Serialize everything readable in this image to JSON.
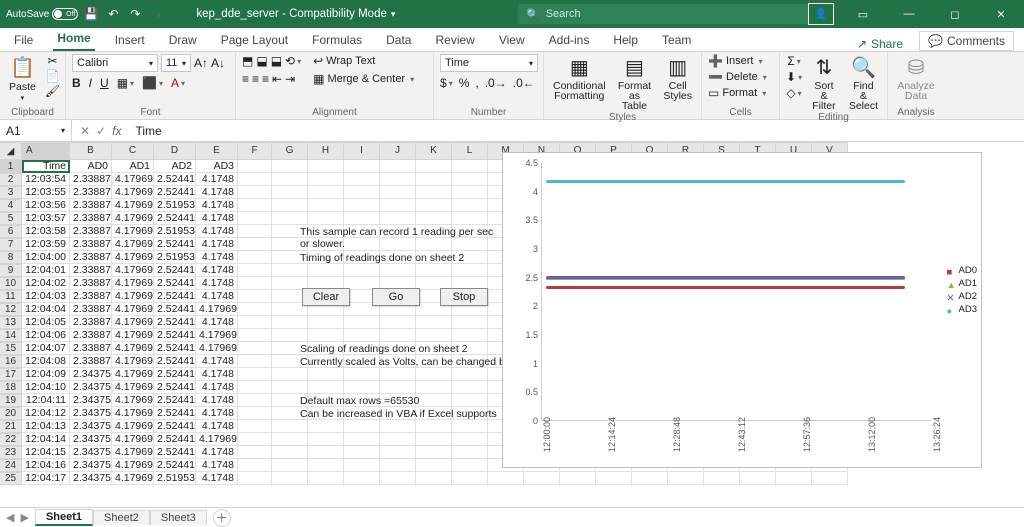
{
  "titlebar": {
    "autosave": "AutoSave",
    "off": "Off",
    "title": "kep_dde_server  -  Compatibility Mode",
    "search_placeholder": "Search"
  },
  "tabs": {
    "file": "File",
    "home": "Home",
    "insert": "Insert",
    "draw": "Draw",
    "pagelayout": "Page Layout",
    "formulas": "Formulas",
    "data": "Data",
    "review": "Review",
    "view": "View",
    "addins": "Add-ins",
    "help": "Help",
    "team": "Team",
    "share": "Share",
    "comments": "Comments"
  },
  "ribbon": {
    "clipboard": "Clipboard",
    "paste": "Paste",
    "font": "Font",
    "font_name": "Calibri",
    "font_size": "11",
    "alignment": "Alignment",
    "wrap": "Wrap Text",
    "merge": "Merge & Center",
    "number": "Number",
    "num_format": "Time",
    "styles": "Styles",
    "condfmt": "Conditional Formatting",
    "fmttable": "Format as Table",
    "cellstyles": "Cell Styles",
    "cells": "Cells",
    "insert": "Insert",
    "delete": "Delete",
    "format": "Format",
    "editing": "Editing",
    "sort": "Sort & Filter",
    "find": "Find & Select",
    "analysis": "Analysis",
    "analyze": "Analyze Data"
  },
  "formula_bar": {
    "cell_ref": "A1",
    "value": "Time"
  },
  "columns": [
    "A",
    "B",
    "C",
    "D",
    "E",
    "F",
    "G",
    "H",
    "I",
    "J",
    "K",
    "L",
    "M",
    "N",
    "O",
    "P",
    "Q",
    "R",
    "S",
    "T",
    "U",
    "V"
  ],
  "headers": {
    "A": "Time",
    "B": "AD0",
    "C": "AD1",
    "D": "AD2",
    "E": "AD3"
  },
  "rows": [
    {
      "t": "12:03:54",
      "b": "2.33887",
      "c": "4.17969",
      "d": "2.52441",
      "e": "4.1748"
    },
    {
      "t": "12:03:55",
      "b": "2.33887",
      "c": "4.17969",
      "d": "2.52441",
      "e": "4.1748"
    },
    {
      "t": "12:03:56",
      "b": "2.33887",
      "c": "4.17969",
      "d": "2.51953",
      "e": "4.1748"
    },
    {
      "t": "12:03:57",
      "b": "2.33887",
      "c": "4.17969",
      "d": "2.52441",
      "e": "4.1748"
    },
    {
      "t": "12:03:58",
      "b": "2.33887",
      "c": "4.17969",
      "d": "2.51953",
      "e": "4.1748"
    },
    {
      "t": "12:03:59",
      "b": "2.33887",
      "c": "4.17969",
      "d": "2.52441",
      "e": "4.1748"
    },
    {
      "t": "12:04:00",
      "b": "2.33887",
      "c": "4.17969",
      "d": "2.51953",
      "e": "4.1748"
    },
    {
      "t": "12:04:01",
      "b": "2.33887",
      "c": "4.17969",
      "d": "2.52441",
      "e": "4.1748"
    },
    {
      "t": "12:04:02",
      "b": "2.33887",
      "c": "4.17969",
      "d": "2.52441",
      "e": "4.1748"
    },
    {
      "t": "12:04:03",
      "b": "2.33887",
      "c": "4.17969",
      "d": "2.52441",
      "e": "4.1748"
    },
    {
      "t": "12:04:04",
      "b": "2.33887",
      "c": "4.17969",
      "d": "2.52441",
      "e": "4.17969"
    },
    {
      "t": "12:04:05",
      "b": "2.33887",
      "c": "4.17969",
      "d": "2.52441",
      "e": "4.1748"
    },
    {
      "t": "12:04:06",
      "b": "2.33887",
      "c": "4.17969",
      "d": "2.52441",
      "e": "4.17969"
    },
    {
      "t": "12:04:07",
      "b": "2.33887",
      "c": "4.17969",
      "d": "2.52441",
      "e": "4.17969"
    },
    {
      "t": "12:04:08",
      "b": "2.33887",
      "c": "4.17969",
      "d": "2.52441",
      "e": "4.1748"
    },
    {
      "t": "12:04:09",
      "b": "2.34375",
      "c": "4.17969",
      "d": "2.52441",
      "e": "4.1748"
    },
    {
      "t": "12:04:10",
      "b": "2.34375",
      "c": "4.17969",
      "d": "2.52441",
      "e": "4.1748"
    },
    {
      "t": "12:04:11",
      "b": "2.34375",
      "c": "4.17969",
      "d": "2.52441",
      "e": "4.1748"
    },
    {
      "t": "12:04:12",
      "b": "2.34375",
      "c": "4.17969",
      "d": "2.52441",
      "e": "4.1748"
    },
    {
      "t": "12:04:13",
      "b": "2.34375",
      "c": "4.17969",
      "d": "2.52441",
      "e": "4.1748"
    },
    {
      "t": "12:04:14",
      "b": "2.34375",
      "c": "4.17969",
      "d": "2.52441",
      "e": "4.17969"
    },
    {
      "t": "12:04:15",
      "b": "2.34375",
      "c": "4.17969",
      "d": "2.52441",
      "e": "4.1748"
    },
    {
      "t": "12:04:16",
      "b": "2.34375",
      "c": "4.17969",
      "d": "2.52441",
      "e": "4.1748"
    },
    {
      "t": "12:04:17",
      "b": "2.34375",
      "c": "4.17969",
      "d": "2.51953",
      "e": "4.1748"
    }
  ],
  "notes": {
    "n1": "This sample can record 1 reading per sec or slower.",
    "n2": "Timing of readings done on sheet 2",
    "n3": "Scaling of readings done on sheet 2",
    "n4": "Currently scaled as Volts, can be changed by use",
    "n5": "Default max rows =65530",
    "n6": "Can be increased in VBA if Excel supports"
  },
  "buttons": {
    "clear": "Clear",
    "go": "Go",
    "stop": "Stop"
  },
  "sheets": {
    "s1": "Sheet1",
    "s2": "Sheet2",
    "s3": "Sheet3"
  },
  "chart_data": {
    "type": "line",
    "x": [
      "12:00:00",
      "12:14:24",
      "12:28:48",
      "12:43:12",
      "12:57:36",
      "13:12:00",
      "13:26:24"
    ],
    "yticks": [
      0,
      0.5,
      1,
      1.5,
      2,
      2.5,
      3,
      3.5,
      4,
      4.5
    ],
    "ylim": [
      0,
      4.5
    ],
    "series": [
      {
        "name": "AD0",
        "color": "#b63a3a",
        "value": 2.34
      },
      {
        "name": "AD1",
        "color": "#8fb741",
        "value": 2.5
      },
      {
        "name": "AD2",
        "color": "#6a58c7",
        "value": 2.52
      },
      {
        "name": "AD3",
        "color": "#4fb7cf",
        "value": 4.18
      }
    ],
    "legend": [
      "AD0",
      "AD1",
      "AD2",
      "AD3"
    ]
  }
}
